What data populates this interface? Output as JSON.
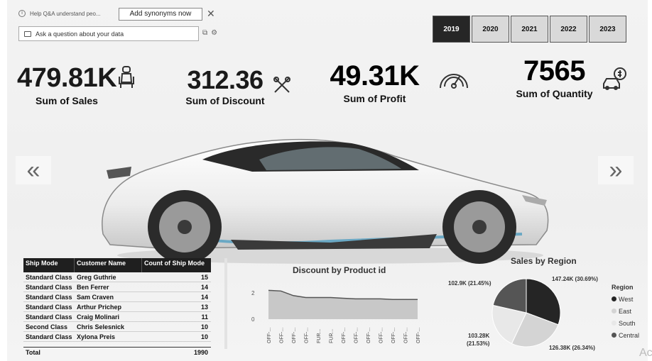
{
  "qa": {
    "hint": "Help Q&A understand peo...",
    "add_synonyms": "Add synonyms now",
    "close": "✕",
    "ask_placeholder": "Ask a question about your data"
  },
  "years": [
    "2019",
    "2020",
    "2021",
    "2022",
    "2023"
  ],
  "selected_year": "2019",
  "kpis": {
    "sales": {
      "value": "479.81K",
      "label": "Sum of Sales",
      "icon": "car-seat-icon"
    },
    "discount": {
      "value": "312.36",
      "label": "Sum of Discount",
      "icon": "tools-icon"
    },
    "profit": {
      "value": "49.31K",
      "label": "Sum of Profit",
      "icon": "speedometer-icon"
    },
    "quantity": {
      "value": "7565",
      "label": "Sum of Quantity",
      "icon": "car-money-icon"
    }
  },
  "nav": {
    "prev": "«",
    "next": "»"
  },
  "table": {
    "headers": [
      "Ship Mode",
      "Customer Name",
      "Count of Ship Mode"
    ],
    "rows": [
      [
        "Standard Class",
        "Greg Guthrie",
        "15"
      ],
      [
        "Standard Class",
        "Ben Ferrer",
        "14"
      ],
      [
        "Standard Class",
        "Sam Craven",
        "14"
      ],
      [
        "Standard Class",
        "Arthur Prichep",
        "13"
      ],
      [
        "Standard Class",
        "Craig Molinari",
        "11"
      ],
      [
        "Second Class",
        "Chris Selesnick",
        "10"
      ],
      [
        "Standard Class",
        "Xylona Preis",
        "10"
      ]
    ],
    "total_label": "Total",
    "total_value": "1990"
  },
  "discount_chart": {
    "title": "Discount by Product id",
    "yticks": [
      "2",
      "0"
    ],
    "xticks": [
      "OFF-...",
      "OFF-...",
      "OFF-...",
      "OFF-...",
      "FUR...",
      "FUR...",
      "OFF-...",
      "OFF-...",
      "OFF-...",
      "OFF-...",
      "OFF-...",
      "OFF-...",
      "OFF-..."
    ]
  },
  "region_chart": {
    "title": "Sales by Region",
    "legend_title": "Region",
    "labels": {
      "West": "147.24K (30.69%)",
      "East": "126.38K (26.34%)",
      "South_line1": "103.28K",
      "South_line2": "(21.53%)",
      "Central": "102.9K (21.45%)"
    }
  },
  "chart_data": [
    {
      "type": "area",
      "title": "Discount by Product id",
      "x": [
        "OFF-1",
        "OFF-2",
        "OFF-3",
        "OFF-4",
        "FUR-1",
        "FUR-2",
        "OFF-5",
        "OFF-6",
        "OFF-7",
        "OFF-8",
        "OFF-9",
        "OFF-10",
        "OFF-11"
      ],
      "values": [
        2.2,
        2.15,
        1.8,
        1.65,
        1.65,
        1.65,
        1.6,
        1.55,
        1.55,
        1.55,
        1.5,
        1.5,
        1.5
      ],
      "ylim": [
        0,
        2.6
      ]
    },
    {
      "type": "pie",
      "title": "Sales by Region",
      "categories": [
        "West",
        "East",
        "South",
        "Central"
      ],
      "values": [
        147.24,
        126.38,
        103.28,
        102.9
      ],
      "colors": [
        "#252525",
        "#d4d4d4",
        "#e8e8e8",
        "#555555"
      ]
    }
  ]
}
